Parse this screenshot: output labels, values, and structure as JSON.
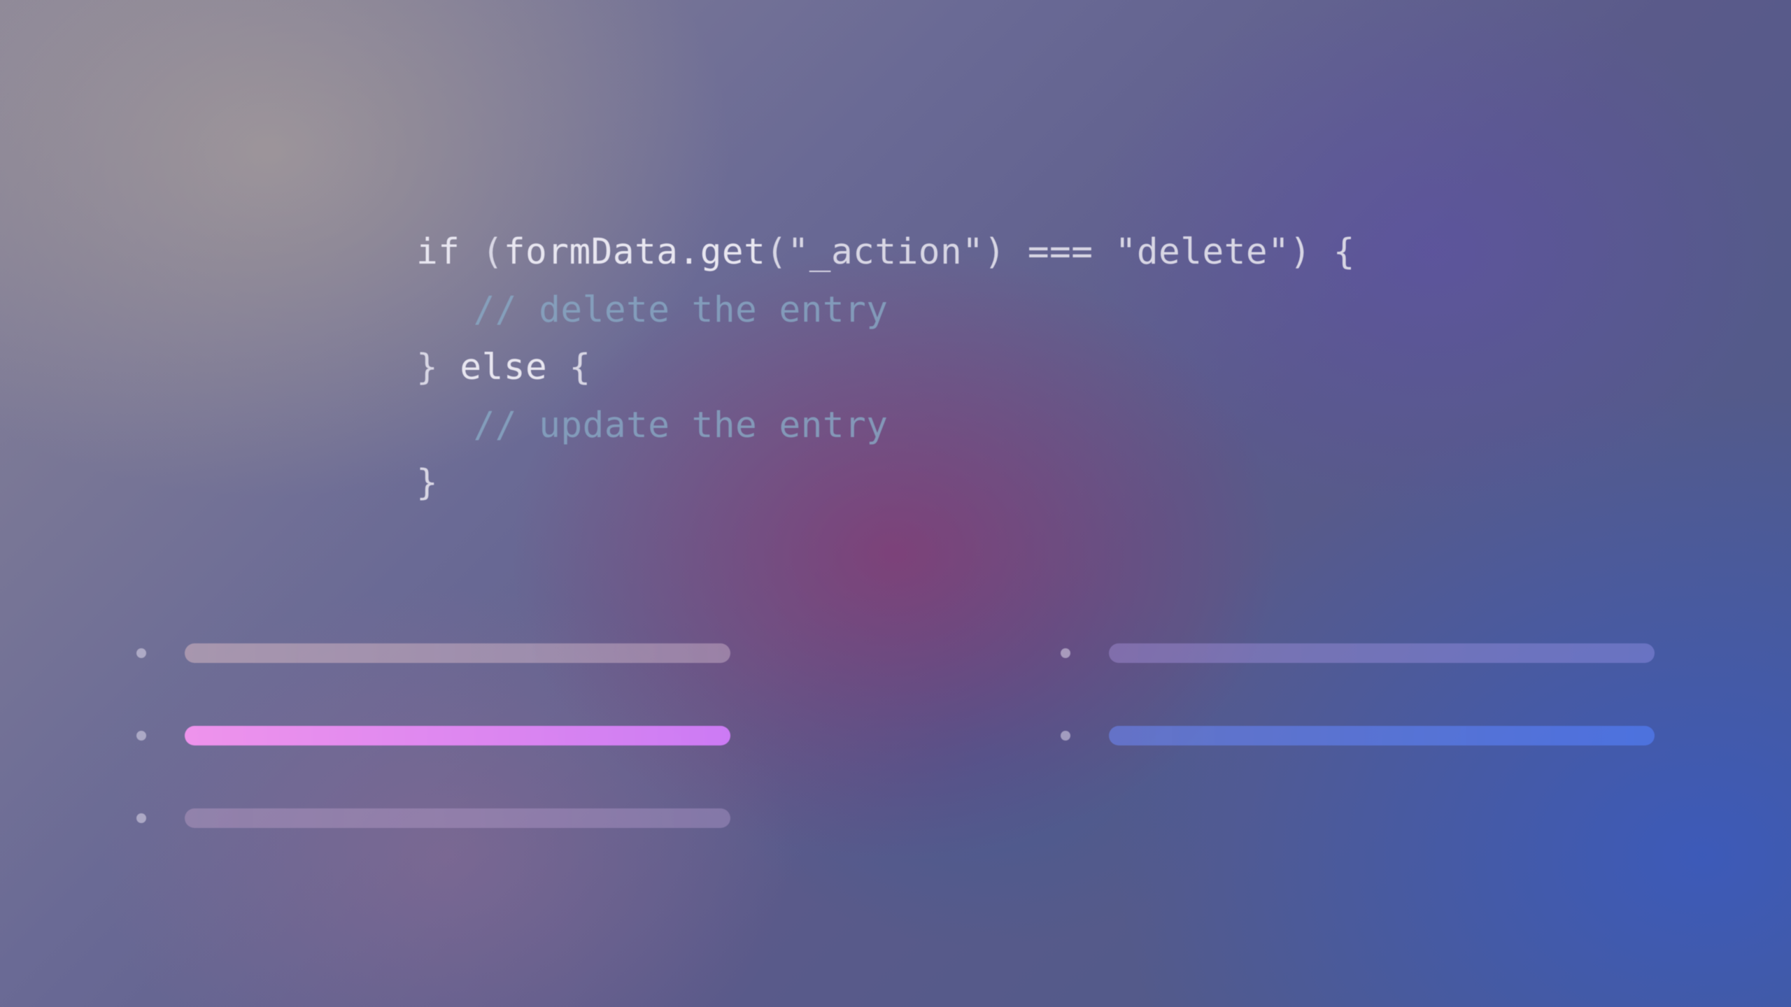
{
  "code": {
    "line1": {
      "kw_if": "if",
      "paren_open": " (",
      "ident": "formData",
      "dot": ".",
      "method": "get",
      "call_open": "(",
      "arg": "\"_action\"",
      "call_close": ")",
      "op": " === ",
      "val": "\"delete\"",
      "paren_close": ")",
      "brace_open": " {"
    },
    "line2": {
      "comment": "// delete the entry"
    },
    "line3": {
      "brace_close": "}",
      "kw_else": " else ",
      "brace_open": "{"
    },
    "line4": {
      "comment": "// update the entry"
    },
    "line5": {
      "brace_close": "}"
    }
  }
}
